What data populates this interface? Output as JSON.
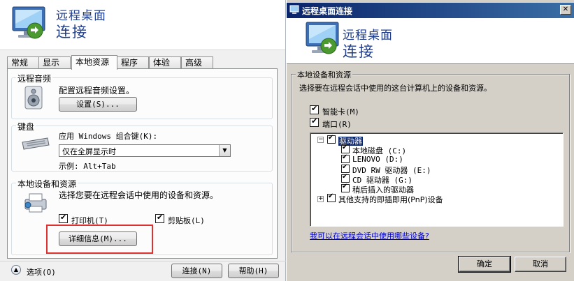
{
  "left": {
    "banner": {
      "line1": "远程桌面",
      "line2": "连接"
    },
    "tabs": [
      "常规",
      "显示",
      "本地资源",
      "程序",
      "体验",
      "高级"
    ],
    "active_tab_index": 2,
    "audio": {
      "legend": "远程音频",
      "desc": "配置远程音频设置。",
      "button": "设置(S)..."
    },
    "keyboard": {
      "legend": "键盘",
      "desc": "应用 Windows 组合键(K):",
      "select_value": "仅在全屏显示时",
      "example": "示例: Alt+Tab"
    },
    "local_devices": {
      "legend": "本地设备和资源",
      "desc": "选择您要在远程会话中使用的设备和资源。",
      "printer_label": "打印机(T)",
      "printer_checked": true,
      "clipboard_label": "剪贴板(L)",
      "clipboard_checked": true,
      "details_button": "详细信息(M)..."
    },
    "footer": {
      "options_label": "选项(O)",
      "connect_button": "连接(N)",
      "help_button": "帮助(H)"
    }
  },
  "right": {
    "title": "远程桌面连接",
    "banner": {
      "line1": "远程桌面",
      "line2": "连接"
    },
    "group_legend": "本地设备和资源",
    "group_desc": "选择要在远程会话中使用的这台计算机上的设备和资源。",
    "smartcard_label": "智能卡(M)",
    "smartcard_checked": true,
    "ports_label": "端口(R)",
    "ports_checked": true,
    "tree": {
      "drives_label": "驱动器",
      "drives": [
        "本地磁盘 (C:)",
        "LENOVO (D:)",
        "DVD RW 驱动器 (E:)",
        "CD 驱动器 (G:)",
        "稍后插入的驱动器"
      ],
      "pnp_label": "其他支持的即插即用(PnP)设备"
    },
    "link": "我可以在远程会话中使用哪些设备?",
    "ok_button": "确定",
    "cancel_button": "取消"
  },
  "colors": {
    "banner_text": "#1e3c8c",
    "highlight_outline": "#e03131",
    "link": "#0000cc"
  }
}
